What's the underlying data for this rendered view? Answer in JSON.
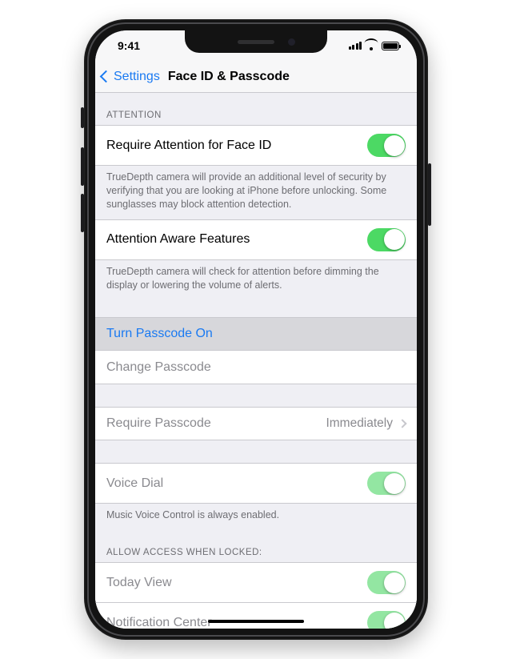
{
  "status": {
    "time": "9:41"
  },
  "nav": {
    "back_label": "Settings",
    "title": "Face ID & Passcode"
  },
  "attention_section": {
    "header": "Attention",
    "require_attention": {
      "label": "Require Attention for Face ID",
      "on": true
    },
    "require_attention_footer": "TrueDepth camera will provide an additional level of security by verifying that you are looking at iPhone before unlocking. Some sunglasses may block attention detection.",
    "aware_features": {
      "label": "Attention Aware Features",
      "on": true
    },
    "aware_features_footer": "TrueDepth camera will check for attention before dimming the display or lowering the volume of alerts."
  },
  "passcode_section": {
    "turn_on": "Turn Passcode On",
    "change": "Change Passcode",
    "require": {
      "label": "Require Passcode",
      "value": "Immediately"
    }
  },
  "voice_section": {
    "voice_dial": {
      "label": "Voice Dial",
      "on": true
    },
    "footer": "Music Voice Control is always enabled."
  },
  "locked_section": {
    "header": "Allow Access When Locked:",
    "today": {
      "label": "Today View",
      "on": true
    },
    "notif": {
      "label": "Notification Center",
      "on": true
    }
  }
}
